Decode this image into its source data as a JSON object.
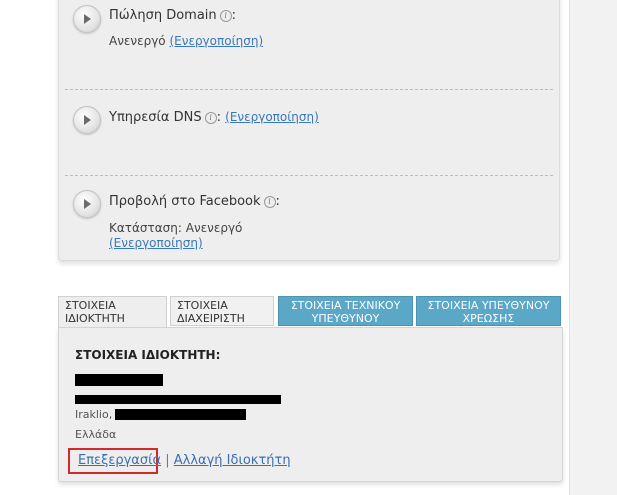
{
  "services": [
    {
      "title": "Πώληση Domain",
      "status_text": "Ανενεργό",
      "action_label": "(Ενεργοποίηση)"
    },
    {
      "title": "Υπηρεσία DNS",
      "action_label": "(Ενεργοποίηση)"
    },
    {
      "title": "Προβολή στο Facebook",
      "status_prefix": "Κατάσταση:",
      "status_text": "Ανενεργό",
      "action_label": "(Ενεργοποίηση)"
    }
  ],
  "info_glyph": "i",
  "tabs": [
    {
      "label_line1": "ΣΤΟΙΧΕΙΑ",
      "label_line2": "ΙΔΙΟΚΤΗΤΗ",
      "state": "active"
    },
    {
      "label_line1": "ΣΤΟΙΧΕΙΑ",
      "label_line2": "ΔΙΑΧΕΙΡΙΣΤΗ",
      "state": "inactive"
    },
    {
      "label_line1": "ΣΤΟΙΧΕΙΑ ΤΕΧΝΙΚΟΥ",
      "label_line2": "ΥΠΕΥΘΥΝΟΥ",
      "state": "inactive-blue"
    },
    {
      "label_line1": "ΣΤΟΙΧΕΙΑ ΥΠΕΥΘΥΝΟΥ",
      "label_line2": "ΧΡΕΩΣΗΣ",
      "state": "inactive-blue"
    }
  ],
  "owner": {
    "heading": "ΣΤΟΙΧΕΙΑ ΙΔΙΟΚΤΗΤΗ:",
    "city_prefix": "Iraklio,",
    "country": "Ελλάδα"
  },
  "actions": {
    "edit_label": "Επεξεργασία",
    "separator": "|",
    "change_owner_label": "Αλλαγή Ιδιοκτήτη"
  },
  "colors": {
    "link": "#3a78b8",
    "tab_blue": "#5aa7c7",
    "highlight_border": "#d22a2a"
  }
}
